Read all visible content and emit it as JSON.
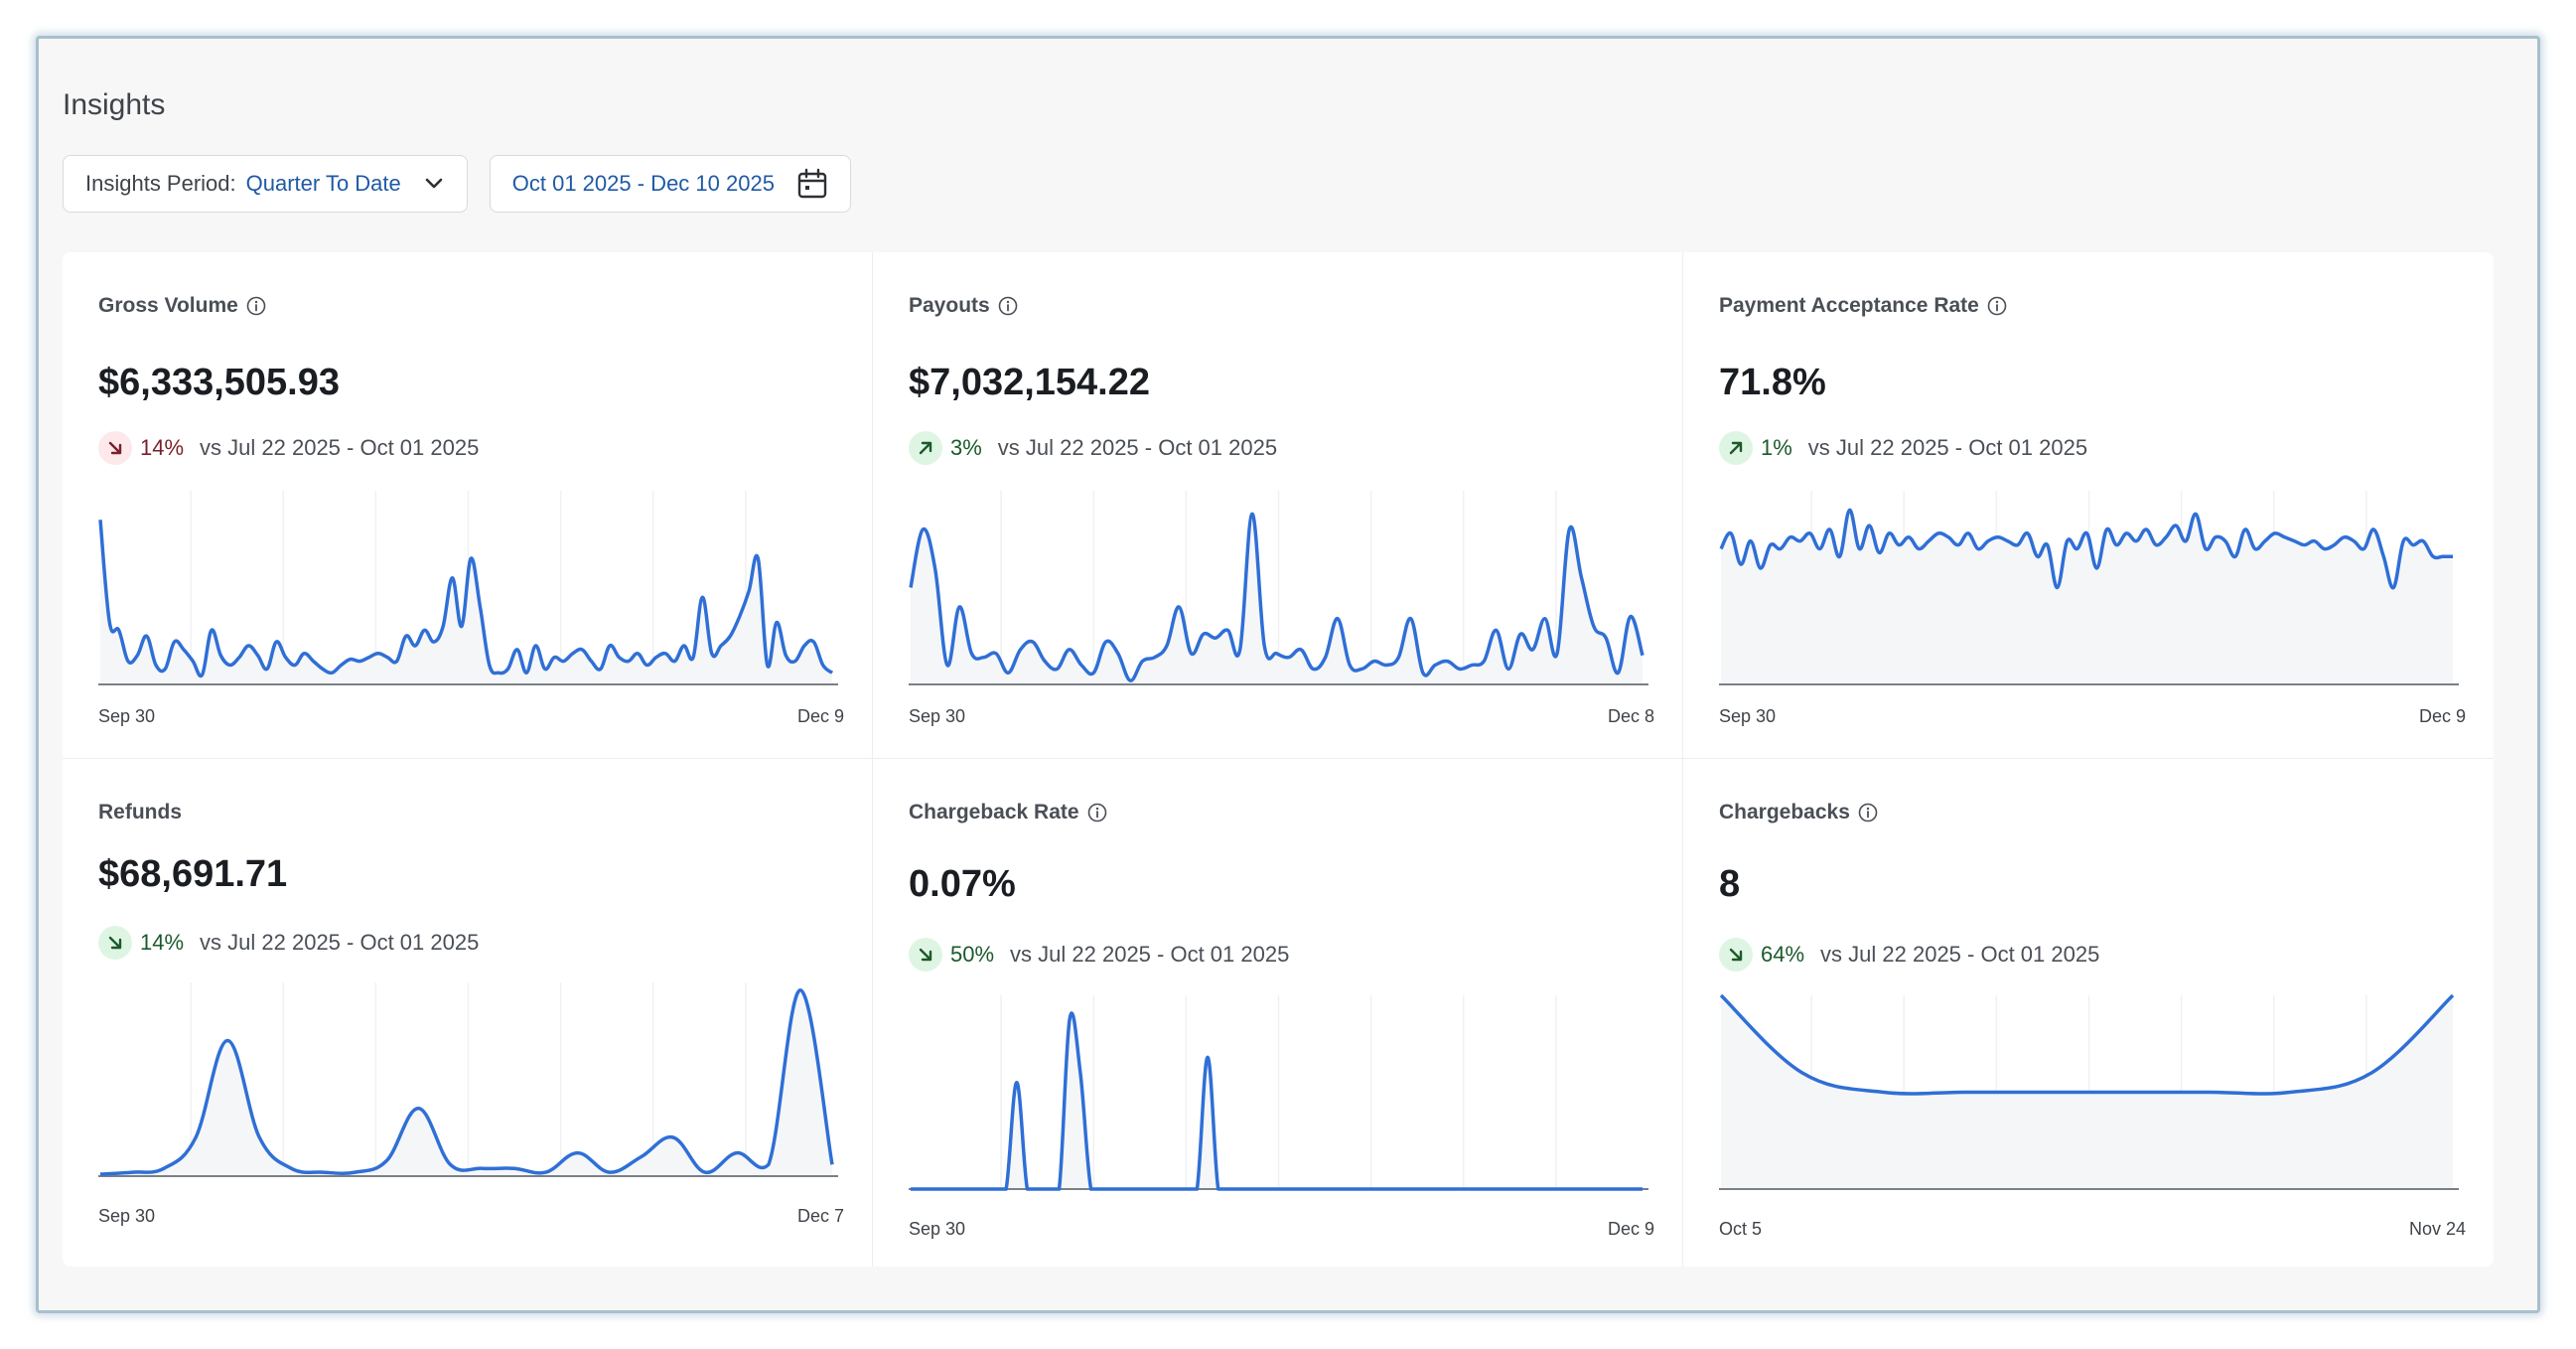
{
  "page": {
    "title": "Insights"
  },
  "controls": {
    "period_label": "Insights Period:",
    "period_value": "Quarter To Date",
    "date_range": "Oct 01 2025 - Dec 10 2025"
  },
  "icons": {
    "chevron": "chevron-down-icon",
    "calendar": "calendar-icon",
    "info": "info-icon",
    "arrow_down": "arrow-down-right-icon",
    "arrow_up": "arrow-up-right-icon"
  },
  "colors": {
    "accent": "#1f5aa6",
    "line": "#2f6fd6",
    "negative": "#7a1f2b",
    "positive": "#1b5a2a"
  },
  "cards": [
    {
      "title": "Gross Volume",
      "value": "$6,333,505.93",
      "delta": "14%",
      "direction": "down",
      "trend": "red",
      "compare": "vs Jul 22 2025 - Oct 01 2025",
      "x_start": "Sep 30",
      "x_end": "Dec 9",
      "has_info": true,
      "series": [
        0.85,
        0.32,
        0.28,
        0.12,
        0.15,
        0.25,
        0.1,
        0.08,
        0.22,
        0.18,
        0.12,
        0.05,
        0.28,
        0.15,
        0.1,
        0.14,
        0.2,
        0.15,
        0.08,
        0.22,
        0.14,
        0.1,
        0.16,
        0.12,
        0.08,
        0.06,
        0.1,
        0.13,
        0.12,
        0.14,
        0.16,
        0.14,
        0.12,
        0.25,
        0.2,
        0.28,
        0.22,
        0.3,
        0.55,
        0.3,
        0.65,
        0.4,
        0.1,
        0.06,
        0.08,
        0.18,
        0.06,
        0.2,
        0.08,
        0.14,
        0.12,
        0.16,
        0.18,
        0.12,
        0.08,
        0.2,
        0.14,
        0.12,
        0.16,
        0.1,
        0.14,
        0.16,
        0.12,
        0.2,
        0.14,
        0.45,
        0.16,
        0.2,
        0.25,
        0.35,
        0.48,
        0.65,
        0.1,
        0.32,
        0.15,
        0.12,
        0.2,
        0.22,
        0.1,
        0.06
      ]
    },
    {
      "title": "Payouts",
      "value": "$7,032,154.22",
      "delta": "3%",
      "direction": "up",
      "trend": "green",
      "compare": "vs Jul 22 2025 - Oct 01 2025",
      "x_start": "Sep 30",
      "x_end": "Dec 8",
      "has_info": true,
      "series": [
        0.5,
        0.8,
        0.6,
        0.1,
        0.4,
        0.16,
        0.14,
        0.16,
        0.06,
        0.18,
        0.22,
        0.12,
        0.08,
        0.18,
        0.1,
        0.06,
        0.22,
        0.16,
        0.02,
        0.12,
        0.14,
        0.2,
        0.4,
        0.16,
        0.26,
        0.24,
        0.28,
        0.18,
        0.88,
        0.2,
        0.16,
        0.14,
        0.18,
        0.08,
        0.14,
        0.34,
        0.1,
        0.08,
        0.12,
        0.1,
        0.14,
        0.34,
        0.06,
        0.1,
        0.12,
        0.08,
        0.1,
        0.12,
        0.28,
        0.08,
        0.26,
        0.18,
        0.34,
        0.16,
        0.8,
        0.55,
        0.3,
        0.24,
        0.06,
        0.35,
        0.15
      ]
    },
    {
      "title": "Payment Acceptance Rate",
      "value": "71.8%",
      "delta": "1%",
      "direction": "up",
      "trend": "green",
      "compare": "vs Jul 22 2025 - Oct 01 2025",
      "x_start": "Sep 30",
      "x_end": "Dec 9",
      "has_info": true,
      "series": [
        0.7,
        0.78,
        0.62,
        0.74,
        0.6,
        0.72,
        0.7,
        0.76,
        0.74,
        0.78,
        0.7,
        0.8,
        0.66,
        0.9,
        0.7,
        0.82,
        0.68,
        0.78,
        0.72,
        0.76,
        0.7,
        0.74,
        0.78,
        0.76,
        0.72,
        0.78,
        0.7,
        0.74,
        0.76,
        0.74,
        0.72,
        0.78,
        0.66,
        0.72,
        0.5,
        0.74,
        0.7,
        0.78,
        0.6,
        0.8,
        0.72,
        0.78,
        0.74,
        0.8,
        0.72,
        0.76,
        0.82,
        0.74,
        0.88,
        0.7,
        0.76,
        0.74,
        0.66,
        0.8,
        0.7,
        0.74,
        0.78,
        0.76,
        0.74,
        0.72,
        0.74,
        0.7,
        0.72,
        0.76,
        0.74,
        0.7,
        0.8,
        0.66,
        0.5,
        0.74,
        0.72,
        0.74,
        0.66,
        0.66,
        0.66
      ]
    },
    {
      "title": "Refunds",
      "value": "$68,691.71",
      "delta": "14%",
      "direction": "down",
      "trend": "green",
      "compare": "vs Jul 22 2025 - Oct 01 2025",
      "x_start": "Sep 30",
      "x_end": "Dec 7",
      "has_info": false,
      "series": [
        0.01,
        0.02,
        0.04,
        0.2,
        0.7,
        0.2,
        0.04,
        0.02,
        0.02,
        0.08,
        0.35,
        0.06,
        0.04,
        0.04,
        0.02,
        0.12,
        0.02,
        0.1,
        0.2,
        0.02,
        0.12,
        0.06,
        0.96,
        0.06
      ]
    },
    {
      "title": "Chargeback Rate",
      "value": "0.07%",
      "delta": "50%",
      "direction": "down",
      "trend": "green",
      "compare": "vs Jul 22 2025 - Oct 01 2025",
      "x_start": "Sep 30",
      "x_end": "Dec 9",
      "has_info": true,
      "series": [
        0,
        0,
        0,
        0,
        0,
        0,
        0,
        0,
        0,
        0,
        0.55,
        0,
        0,
        0,
        0,
        0.88,
        0.6,
        0,
        0,
        0,
        0,
        0,
        0,
        0,
        0,
        0,
        0,
        0,
        0.68,
        0,
        0,
        0,
        0,
        0,
        0,
        0,
        0,
        0,
        0,
        0,
        0,
        0,
        0,
        0,
        0,
        0,
        0,
        0,
        0,
        0,
        0,
        0,
        0,
        0,
        0,
        0,
        0,
        0,
        0,
        0,
        0,
        0,
        0,
        0,
        0,
        0,
        0,
        0,
        0,
        0
      ]
    },
    {
      "title": "Chargebacks",
      "value": "8",
      "delta": "64%",
      "direction": "down",
      "trend": "green",
      "compare": "vs Jul 22 2025 - Oct 01 2025",
      "x_start": "Oct 5",
      "x_end": "Nov 24",
      "has_info": true,
      "series": [
        1.0,
        0.6,
        0.5,
        0.5,
        0.5,
        0.5,
        0.5,
        0.5,
        0.6,
        1.0
      ]
    }
  ]
}
